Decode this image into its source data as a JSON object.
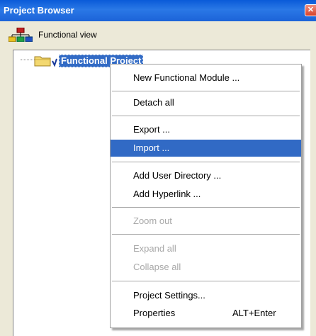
{
  "window": {
    "title": "Project Browser",
    "close_glyph": "✕"
  },
  "view": {
    "label": "Functional view",
    "icon": "hierarchy-icon"
  },
  "tree": {
    "root_label": "Functional Project",
    "root_icon": "folder-icon"
  },
  "context_menu": {
    "items": [
      {
        "label": "New Functional Module ...",
        "enabled": true
      },
      {
        "label": "Detach all",
        "enabled": true
      },
      {
        "label": "Export ...",
        "enabled": true
      },
      {
        "label": "Import ...",
        "enabled": true,
        "highlighted": true
      },
      {
        "label": "Add User Directory ...",
        "enabled": true
      },
      {
        "label": "Add Hyperlink ...",
        "enabled": true
      },
      {
        "label": "Zoom out",
        "enabled": false
      },
      {
        "label": "Expand all",
        "enabled": false
      },
      {
        "label": "Collapse all",
        "enabled": false
      },
      {
        "label": "Project Settings...",
        "enabled": true
      },
      {
        "label": "Properties",
        "shortcut": "ALT+Enter",
        "enabled": true
      }
    ]
  },
  "colors": {
    "title_bar": "#0a5bd8",
    "selection": "#316ac5",
    "disabled_text": "#a8a8a8"
  }
}
